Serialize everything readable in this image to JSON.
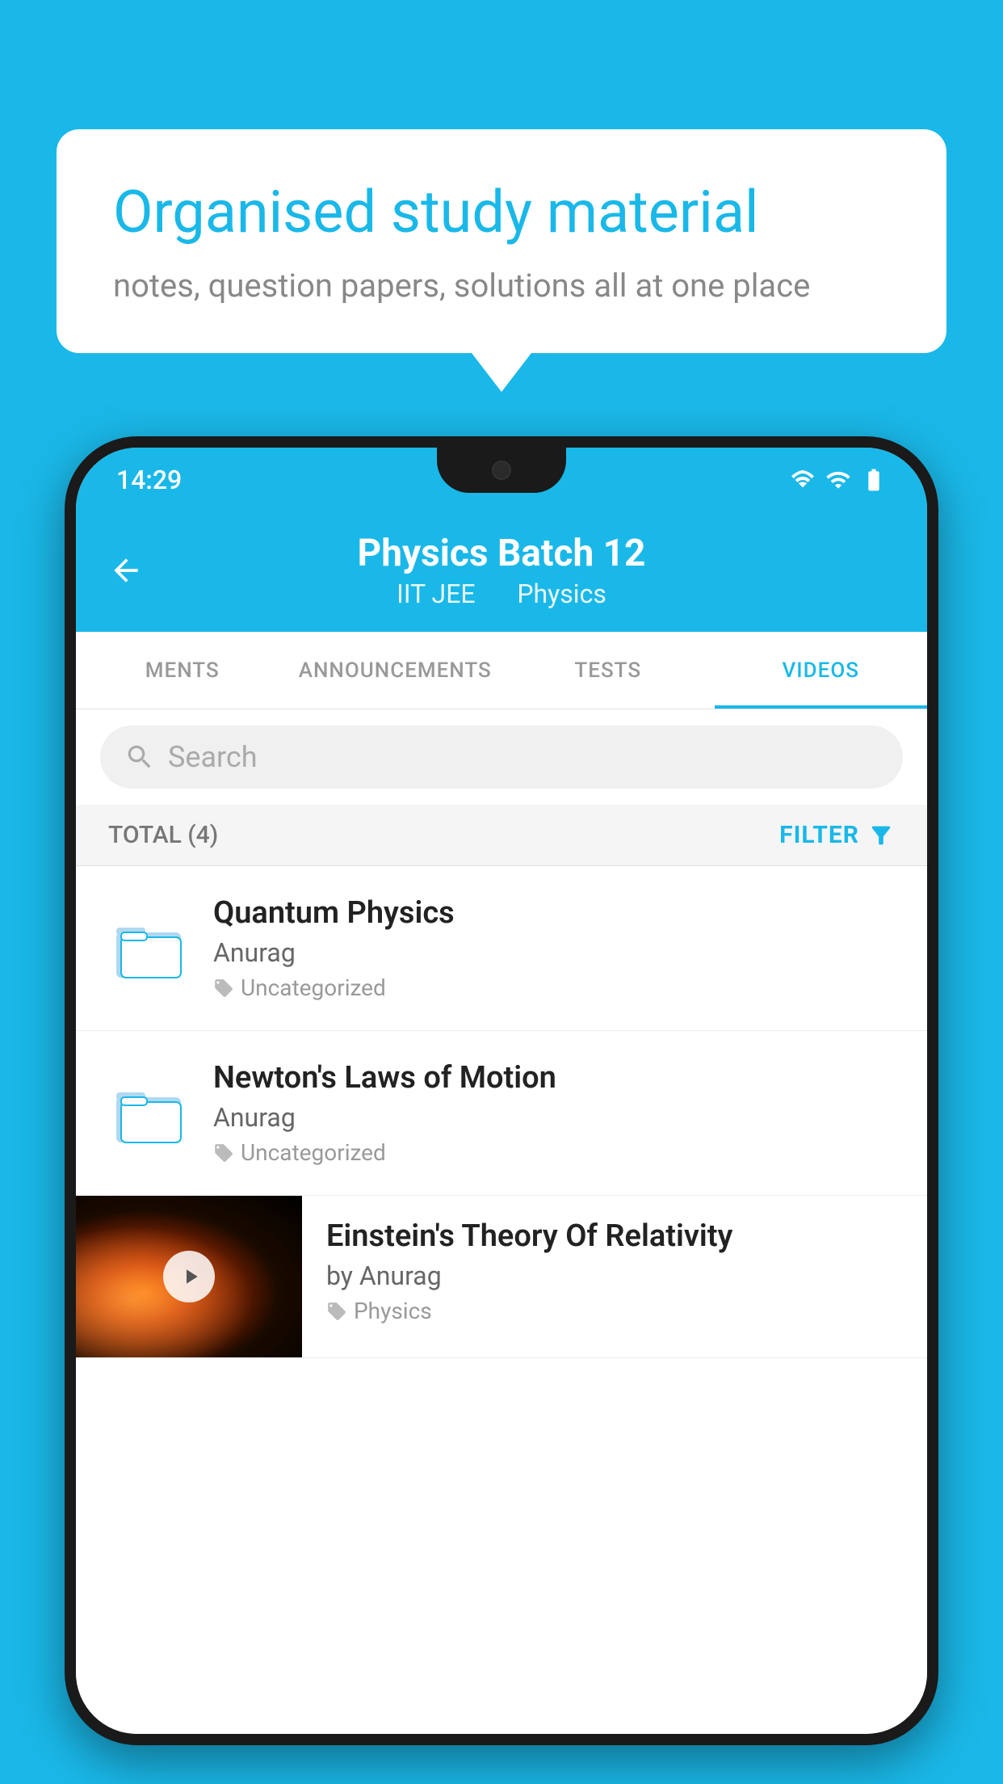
{
  "background_color": "#1ab8e8",
  "bubble": {
    "title": "Organised study material",
    "subtitle": "notes, question papers, solutions all at one place"
  },
  "phone": {
    "status_bar": {
      "time": "14:29"
    },
    "header": {
      "title": "Physics Batch 12",
      "subtitle_left": "IIT JEE",
      "subtitle_right": "Physics",
      "back_label": "back"
    },
    "tabs": [
      {
        "label": "MENTS",
        "active": false
      },
      {
        "label": "ANNOUNCEMENTS",
        "active": false
      },
      {
        "label": "TESTS",
        "active": false
      },
      {
        "label": "VIDEOS",
        "active": true
      }
    ],
    "search": {
      "placeholder": "Search"
    },
    "filter": {
      "total_label": "TOTAL (4)",
      "filter_label": "FILTER"
    },
    "videos": [
      {
        "id": 1,
        "title": "Quantum Physics",
        "author": "Anurag",
        "tag": "Uncategorized",
        "type": "folder"
      },
      {
        "id": 2,
        "title": "Newton's Laws of Motion",
        "author": "Anurag",
        "tag": "Uncategorized",
        "type": "folder"
      },
      {
        "id": 3,
        "title": "Einstein's Theory Of Relativity",
        "author": "by Anurag",
        "tag": "Physics",
        "type": "video"
      }
    ]
  }
}
